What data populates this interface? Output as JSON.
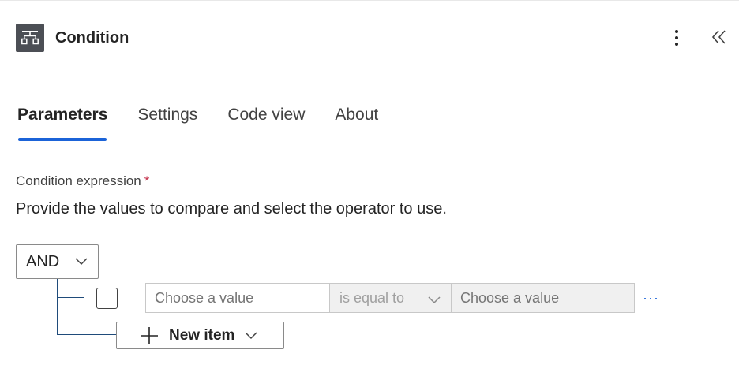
{
  "panel": {
    "title": "Condition",
    "icon": "condition-icon"
  },
  "tabs": [
    {
      "label": "Parameters",
      "active": true
    },
    {
      "label": "Settings",
      "active": false
    },
    {
      "label": "Code view",
      "active": false
    },
    {
      "label": "About",
      "active": false
    }
  ],
  "field": {
    "label": "Condition expression",
    "required_mark": "*",
    "description": "Provide the values to compare and select the operator to use."
  },
  "group": {
    "operator": "AND"
  },
  "row": {
    "left_placeholder": "Choose a value",
    "operator": "is equal to",
    "right_placeholder": "Choose a value",
    "more": "···"
  },
  "new_item": {
    "label": "New item"
  },
  "colors": {
    "accent": "#1b63d8",
    "tree_line": "#1f4b7a",
    "header_icon_bg": "#4c4f55",
    "required": "#c4314b"
  }
}
